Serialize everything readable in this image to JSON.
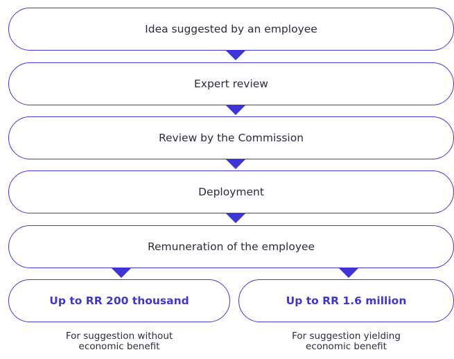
{
  "steps": [
    {
      "label": "Idea suggested by an employee"
    },
    {
      "label": "Expert review"
    },
    {
      "label": "Review by the Commission"
    },
    {
      "label": "Deployment"
    },
    {
      "label": "Remuneration of the employee"
    }
  ],
  "outcomes": [
    {
      "amount": "Up to RR 200 thousand",
      "caption": "For suggestion without\neconomic benefit"
    },
    {
      "amount": "Up to RR 1.6 million",
      "caption": "For suggestion yielding\neconomic benefit"
    }
  ],
  "colors": {
    "accent": "#3d35d6",
    "text": "#2b2b3a",
    "background": "#ffffff"
  }
}
